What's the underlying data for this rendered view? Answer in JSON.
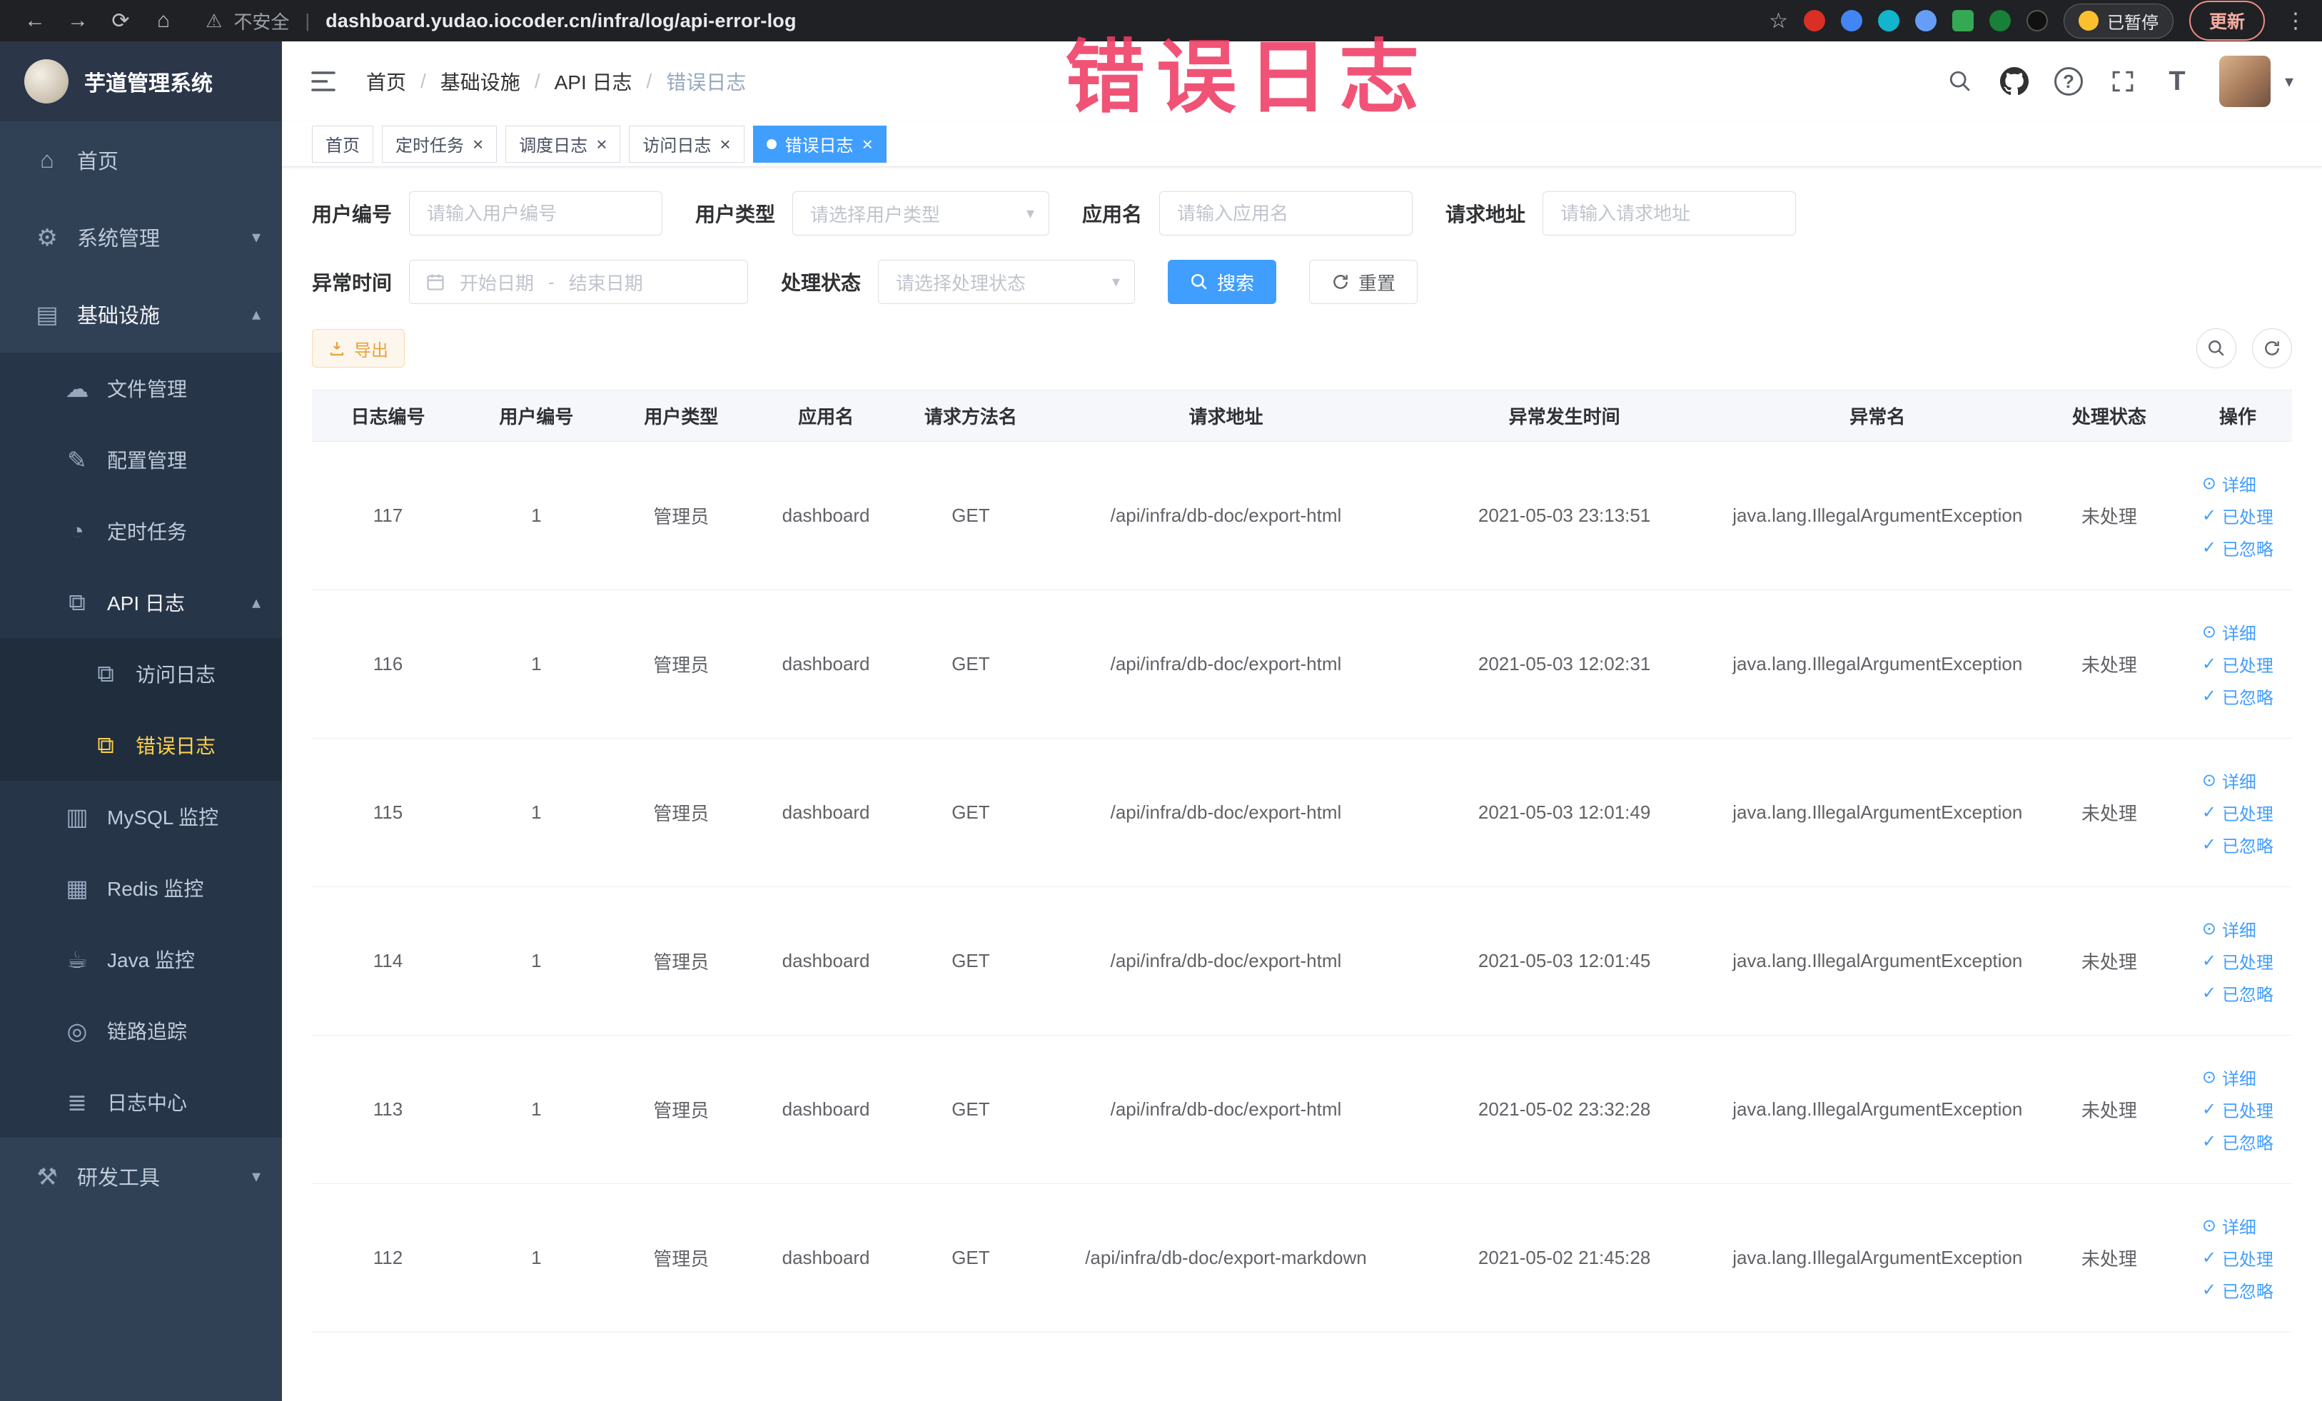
{
  "colors": {
    "accent": "#409eff",
    "warning": "#e6a23c",
    "sidebar_bg": "#304156",
    "submenu_bg": "#273549",
    "active_text": "#ffd04b",
    "annotation": "#ee3b63"
  },
  "annotation": {
    "text": "错误日志"
  },
  "browser": {
    "security_label": "不安全",
    "url": "dashboard.yudao.iocoder.cn/infra/log/api-error-log",
    "paused_badge": "已暂停",
    "update_button": "更新"
  },
  "icons": {
    "back": "←",
    "forward": "→",
    "reload": "⟳",
    "home": "⌂",
    "warning": "⚠",
    "star": "☆",
    "kebab": "⋮",
    "close": "×",
    "caret_down": "▾",
    "chevron_up": "▴",
    "chevron_down": "▾",
    "question": "?",
    "font_size": "T",
    "eye": "⊙",
    "check": "✓",
    "refresh": "⟳",
    "menu_home": "⌂",
    "menu_system": "⚙",
    "menu_infra": "▤",
    "menu_file": "☁",
    "menu_config": "✎",
    "menu_job": "◔",
    "menu_api": "⧉",
    "menu_access": "⧉",
    "menu_error": "⧉",
    "menu_mysql": "▥",
    "menu_redis": "▦",
    "menu_java": "☕",
    "menu_trace": "◎",
    "menu_logcenter": "≣",
    "menu_dev": "⚒"
  },
  "sidebar": {
    "logo_title": "芋道管理系统",
    "items": [
      {
        "label": "首页"
      },
      {
        "label": "系统管理"
      },
      {
        "label": "基础设施"
      },
      {
        "label": "文件管理"
      },
      {
        "label": "配置管理"
      },
      {
        "label": "定时任务"
      },
      {
        "label": "API 日志"
      },
      {
        "label": "访问日志"
      },
      {
        "label": "错误日志"
      },
      {
        "label": "MySQL 监控"
      },
      {
        "label": "Redis 监控"
      },
      {
        "label": "Java 监控"
      },
      {
        "label": "链路追踪"
      },
      {
        "label": "日志中心"
      },
      {
        "label": "研发工具"
      }
    ]
  },
  "breadcrumb": {
    "separator": "/",
    "items": [
      "首页",
      "基础设施",
      "API 日志",
      "错误日志"
    ]
  },
  "tabs": [
    {
      "label": "首页",
      "closable": false,
      "active": false
    },
    {
      "label": "定时任务",
      "closable": true,
      "active": false
    },
    {
      "label": "调度日志",
      "closable": true,
      "active": false
    },
    {
      "label": "访问日志",
      "closable": true,
      "active": false
    },
    {
      "label": "错误日志",
      "closable": true,
      "active": true
    }
  ],
  "filters": {
    "user_id": {
      "label": "用户编号",
      "placeholder": "请输入用户编号"
    },
    "user_type": {
      "label": "用户类型",
      "placeholder": "请选择用户类型"
    },
    "app_name": {
      "label": "应用名",
      "placeholder": "请输入应用名"
    },
    "request_url": {
      "label": "请求地址",
      "placeholder": "请输入请求地址"
    },
    "exception_time": {
      "label": "异常时间",
      "start_placeholder": "开始日期",
      "separator": "-",
      "end_placeholder": "结束日期"
    },
    "process_status": {
      "label": "处理状态",
      "placeholder": "请选择处理状态"
    },
    "search_button": "搜索",
    "reset_button": "重置"
  },
  "toolbar": {
    "export_button": "导出"
  },
  "table": {
    "columns": [
      "日志编号",
      "用户编号",
      "用户类型",
      "应用名",
      "请求方法名",
      "请求地址",
      "异常发生时间",
      "异常名",
      "处理状态",
      "操作"
    ],
    "action_labels": {
      "detail": "详细",
      "processed": "已处理",
      "ignored": "已忽略"
    },
    "rows": [
      {
        "id": "117",
        "user_id": "1",
        "user_type": "管理员",
        "app": "dashboard",
        "method": "GET",
        "url": "/api/infra/db-doc/export-html",
        "time": "2021-05-03 23:13:51",
        "exception": "java.lang.IllegalArgumentException",
        "status": "未处理"
      },
      {
        "id": "116",
        "user_id": "1",
        "user_type": "管理员",
        "app": "dashboard",
        "method": "GET",
        "url": "/api/infra/db-doc/export-html",
        "time": "2021-05-03 12:02:31",
        "exception": "java.lang.IllegalArgumentException",
        "status": "未处理"
      },
      {
        "id": "115",
        "user_id": "1",
        "user_type": "管理员",
        "app": "dashboard",
        "method": "GET",
        "url": "/api/infra/db-doc/export-html",
        "time": "2021-05-03 12:01:49",
        "exception": "java.lang.IllegalArgumentException",
        "status": "未处理"
      },
      {
        "id": "114",
        "user_id": "1",
        "user_type": "管理员",
        "app": "dashboard",
        "method": "GET",
        "url": "/api/infra/db-doc/export-html",
        "time": "2021-05-03 12:01:45",
        "exception": "java.lang.IllegalArgumentException",
        "status": "未处理"
      },
      {
        "id": "113",
        "user_id": "1",
        "user_type": "管理员",
        "app": "dashboard",
        "method": "GET",
        "url": "/api/infra/db-doc/export-html",
        "time": "2021-05-02 23:32:28",
        "exception": "java.lang.IllegalArgumentException",
        "status": "未处理"
      },
      {
        "id": "112",
        "user_id": "1",
        "user_type": "管理员",
        "app": "dashboard",
        "method": "GET",
        "url": "/api/infra/db-doc/export-markdown",
        "time": "2021-05-02 21:45:28",
        "exception": "java.lang.IllegalArgumentException",
        "status": "未处理"
      }
    ]
  }
}
